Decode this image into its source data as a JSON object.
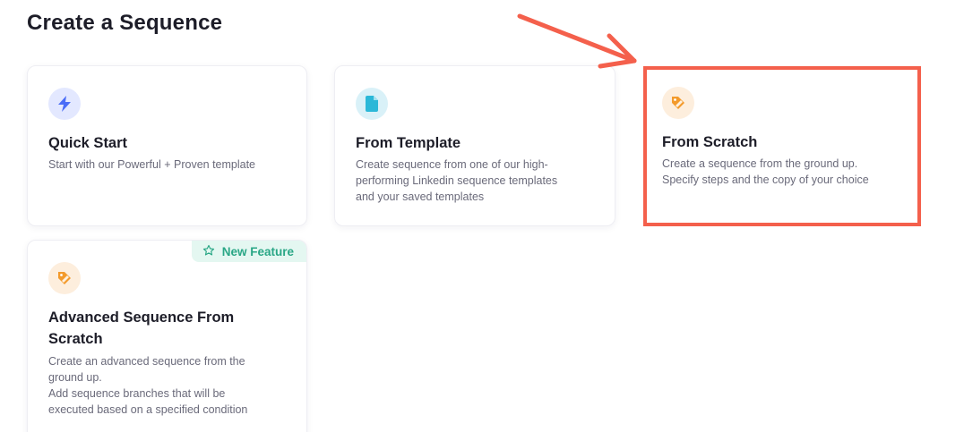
{
  "page": {
    "title": "Create a Sequence"
  },
  "cards": {
    "quick_start": {
      "title": "Quick Start",
      "description": "Start with our Powerful + Proven template",
      "icon": "lightning-bolt-icon"
    },
    "from_template": {
      "title": "From Template",
      "description": "Create sequence from one of our high-\nperforming Linkedin sequence templates\nand your saved templates",
      "icon": "document-icon"
    },
    "from_scratch": {
      "title": "From Scratch",
      "description": "Create a sequence from the ground up.\nSpecify steps and the copy of your choice",
      "icon": "pen-tag-icon",
      "highlighted": true
    },
    "advanced": {
      "title": "Advanced Sequence From\nScratch",
      "description": "Create an advanced sequence from the\nground up.\nAdd sequence branches that will be\nexecuted based on a specified condition",
      "icon": "pen-tag-icon",
      "badge": "New Feature",
      "badge_icon": "star-outline-icon"
    }
  },
  "colors": {
    "highlight": "#f4604c",
    "badge_text": "#2aa786",
    "badge_bg": "#e4f7f1",
    "quick_icon": "#4a6cf7",
    "template_icon": "#2bb8d8",
    "scratch_icon": "#f39a2b"
  }
}
